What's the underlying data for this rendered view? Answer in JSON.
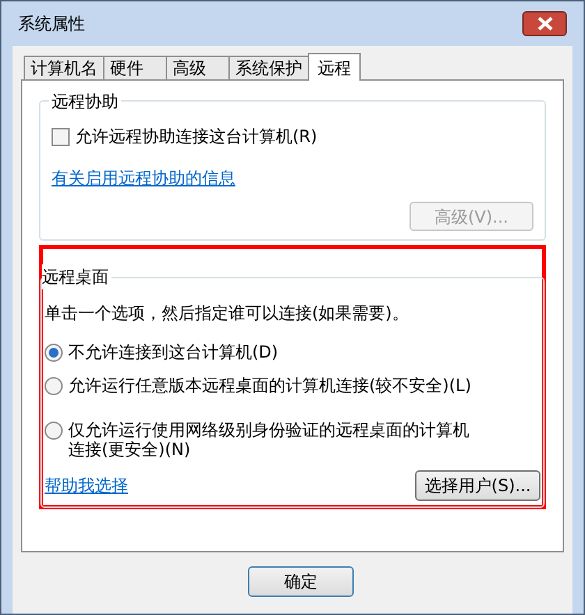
{
  "window": {
    "title": "系统属性"
  },
  "tabs": [
    {
      "label": "计算机名",
      "selected": false
    },
    {
      "label": "硬件",
      "selected": false
    },
    {
      "label": "高级",
      "selected": false
    },
    {
      "label": "系统保护",
      "selected": false
    },
    {
      "label": "远程",
      "selected": true
    }
  ],
  "remote_assistance": {
    "title": "远程协助",
    "checkbox": {
      "label": "允许远程协助连接这台计算机(R)",
      "checked": false
    },
    "link": "有关启用远程协助的信息",
    "advanced_button": {
      "label": "高级(V)...",
      "disabled": true
    }
  },
  "remote_desktop": {
    "title": "远程桌面",
    "instruction": "单击一个选项，然后指定谁可以连接(如果需要)。",
    "options": [
      {
        "label": "不允许连接到这台计算机(D)",
        "selected": true
      },
      {
        "label": "允许运行任意版本远程桌面的计算机连接(较不安全)(L)",
        "selected": false
      },
      {
        "label": "仅允许运行使用网络级别身份验证的远程桌面的计算机连接(更安全)(N)",
        "selected": false
      }
    ],
    "help_link": "帮助我选择",
    "select_users_button": "选择用户(S)..."
  },
  "buttons": [
    "确定"
  ]
}
